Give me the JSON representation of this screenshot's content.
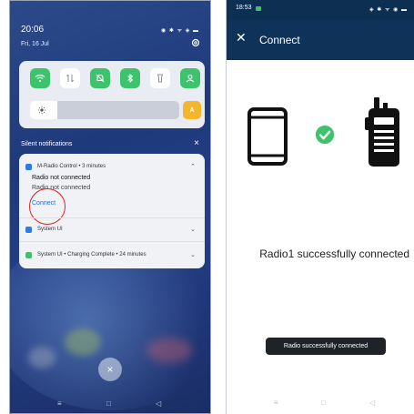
{
  "left_phone": {
    "time": "20:06",
    "date": "Fri, 16 Jul",
    "status_icons": "◉ ✱ ᯤ ◈ ▬",
    "quick_settings": {
      "tiles": [
        {
          "name": "wifi-icon",
          "state": "on"
        },
        {
          "name": "mobile-data-icon",
          "state": "off"
        },
        {
          "name": "bell-icon",
          "state": "on"
        },
        {
          "name": "bluetooth-icon",
          "state": "on"
        },
        {
          "name": "flashlight-icon",
          "state": "off"
        },
        {
          "name": "person-icon",
          "state": "on"
        }
      ],
      "brightness_level": 0.18,
      "auto_label": "A"
    },
    "section_label": "Silent notifications",
    "notifications": [
      {
        "app": "M-Radio Control • 3 minutes",
        "title": "Radio not connected",
        "body": "Radio not connected",
        "action": "Connect"
      },
      {
        "app": "System UI"
      },
      {
        "app": "System UI • Charging Complete • 24 minutes"
      }
    ],
    "dismiss_label": "×",
    "nav": [
      "≡",
      "□",
      "◁"
    ]
  },
  "right_phone": {
    "time": "18:53",
    "status_icons": "◈ ✱ ᯤ ◉ ▬",
    "title": "Connect",
    "close_label": "✕",
    "message": "Radio1 successfully connected",
    "toast": "Radio successfully connected",
    "nav": [
      "≡",
      "□",
      "◁"
    ]
  },
  "colors": {
    "accent_green": "#3cc36b",
    "appbar": "#0f3358",
    "link_blue": "#1e6fd1",
    "annotation_red": "#d9202a"
  }
}
